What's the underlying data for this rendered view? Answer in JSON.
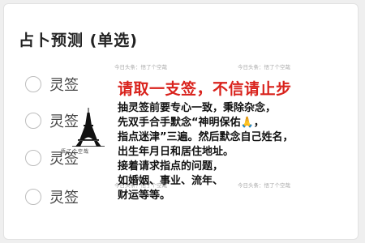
{
  "question": {
    "title": "占卜预测 (单选)",
    "options": [
      {
        "label": "灵签"
      },
      {
        "label": "灵签"
      },
      {
        "label": "灵签"
      },
      {
        "label": "灵签"
      }
    ]
  },
  "watermarks": [
    "今日头条：悟了个空哉",
    "今日头条：悟了个空哉",
    "今日头条：悟了个空哉",
    "今日头条：悟了个空哉"
  ],
  "overlay": {
    "headline": "请取一支签，不信请止步",
    "lines": [
      "抽灵签前要专心一致，秉除杂念，",
      "先双手合手默念“神明保佑🙏，",
      "指点迷津”三遍。然后默念自己姓名，",
      "出生年月日和居住地址。",
      "接着请求指点的问题，",
      "如婚姻、事业、流年、",
      "财运等等。"
    ],
    "tower_caption": "悟了个空哉"
  },
  "colors": {
    "headline": "#d9221c",
    "text": "#111111",
    "radio_border": "#bdbdbd"
  }
}
